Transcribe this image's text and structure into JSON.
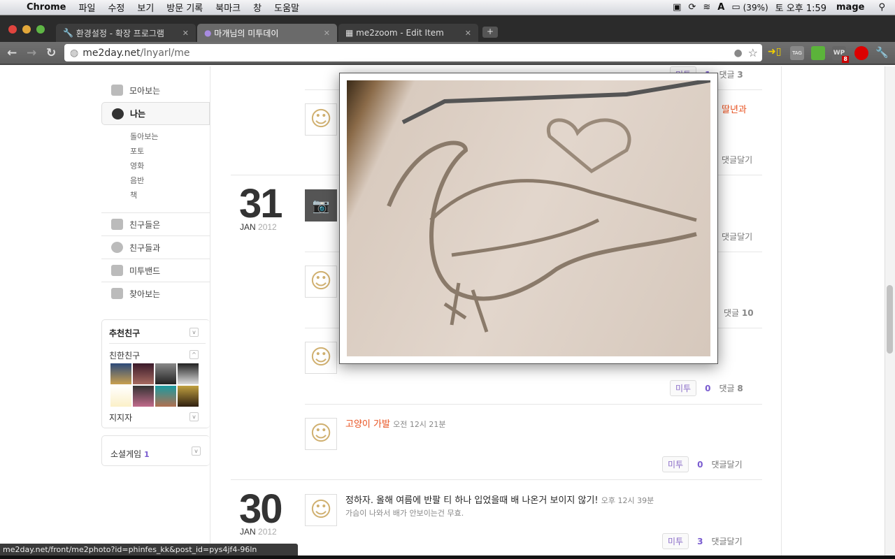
{
  "menubar": {
    "app": "Chrome",
    "items": [
      "파일",
      "수정",
      "보기",
      "방문 기록",
      "북마크",
      "창",
      "도움말"
    ],
    "battery": "(39%)",
    "clock": "토 오후 1:59",
    "user": "mage"
  },
  "tabs": [
    {
      "title": "환경설정 - 확장 프로그램"
    },
    {
      "title": "마개님의 미투데이",
      "active": true
    },
    {
      "title": "me2zoom - Edit Item"
    }
  ],
  "address": {
    "host": "me2day.net",
    "path": "/lnyarl/me"
  },
  "extensions": [
    {
      "name": "WP",
      "badge": "8"
    }
  ],
  "sidebar": {
    "items": [
      "모아보는",
      "나는"
    ],
    "sub_items": [
      "돌아보는",
      "포토",
      "영화",
      "음반",
      "책"
    ],
    "items2": [
      "친구들은",
      "친구들과",
      "미투밴드",
      "찾아보는"
    ],
    "recommend": {
      "title": "추천친구",
      "close_friends": "친한친구",
      "supporters": "지지자"
    },
    "social_game": {
      "label": "소셜게임",
      "count": "1"
    }
  },
  "dates": [
    {
      "day": "31",
      "month": "JAN",
      "year": "2012"
    },
    {
      "day": "30",
      "month": "JAN",
      "year": "2012"
    }
  ],
  "posts": [
    {
      "metoo": "미투",
      "metoo_count": "1",
      "comment": "댓글",
      "comment_count": "3"
    },
    {
      "title_partial": "딸년과",
      "comment_link": "댓글달기"
    },
    {
      "comment_link": "댓글달기"
    },
    {
      "comment": "댓글",
      "comment_count": "10"
    },
    {
      "metoo": "미투",
      "metoo_count": "0",
      "comment": "댓글",
      "comment_count": "8"
    },
    {
      "title": "고양이 가발",
      "time": "오전 12시 21분",
      "metoo": "미투",
      "metoo_count": "0",
      "comment_link": "댓글달기"
    },
    {
      "title": "정하자. 올해 여름에 반팔 티 하나 입었을때 배 나온거 보이지 않기!",
      "time": "오후 12시 39분",
      "sub": "가슴이 나와서 배가 안보이는건 무효.",
      "metoo": "미투",
      "metoo_count": "3",
      "comment_link": "댓글달기"
    }
  ],
  "status_url": "me2day.net/front/me2photo?id=phinfes_kk&post_id=pys4jf4-96ln",
  "colors": {
    "accent_orange": "#e8501e",
    "metoo_purple": "#7a5cd0",
    "smiley_gold": "#d0b070"
  }
}
